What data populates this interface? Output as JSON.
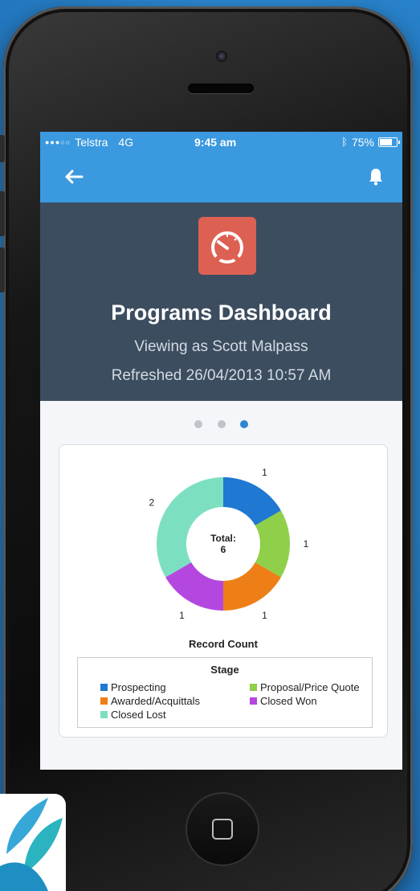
{
  "status_bar": {
    "carrier": "Telstra",
    "network": "4G",
    "time": "9:45 am",
    "battery": "75%",
    "battery_level": 0.75
  },
  "nav": {
    "back_icon": "left-arrow-icon",
    "bell_icon": "bell-icon"
  },
  "header": {
    "icon": "speedometer-icon",
    "title": "Programs Dashboard",
    "viewing_as": "Viewing as Scott Malpass",
    "refreshed": "Refreshed 26/04/2013 10:57 AM"
  },
  "pager": {
    "count": 3,
    "active": 3
  },
  "chart_data": {
    "type": "pie",
    "variant": "donut",
    "title": "Record Count",
    "center_label": "Total:",
    "center_value": "6",
    "legend_title": "Stage",
    "slices": [
      {
        "name": "Prospecting",
        "value": 1,
        "color": "#1f78d1"
      },
      {
        "name": "Proposal/Price Quote",
        "value": 1,
        "color": "#8fcf4a"
      },
      {
        "name": "Awarded/Acquittals",
        "value": 1,
        "color": "#ee7f16"
      },
      {
        "name": "Closed Won",
        "value": 1,
        "color": "#b447e0"
      },
      {
        "name": "Closed Lost",
        "value": 2,
        "color": "#7ddfc1"
      }
    ]
  },
  "colors": {
    "nav_blue": "#3b99df",
    "header_bg": "#3c4d60",
    "icon_red": "#dd6152"
  }
}
